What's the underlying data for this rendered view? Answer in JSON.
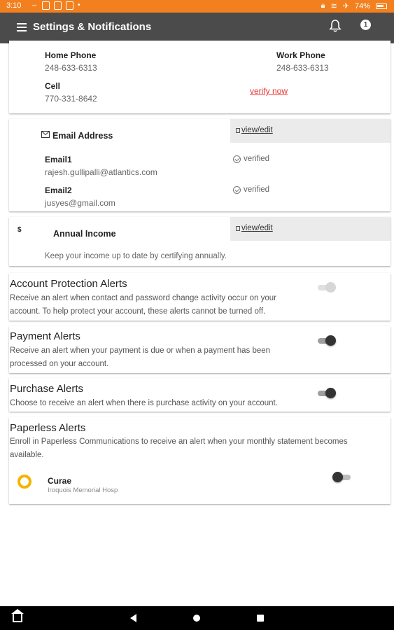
{
  "status_bar": {
    "time": "3:10",
    "battery": "74%"
  },
  "app_bar": {
    "title": "Settings & Notifications",
    "notification_count": "1"
  },
  "phones": {
    "home_label": "Home Phone",
    "home_value": "248-633-6313",
    "work_label": "Work Phone",
    "work_value": "248-633-6313",
    "cell_label": "Cell",
    "cell_value": "770-331-8642",
    "verify_link": "verify now"
  },
  "email": {
    "section_title": "Email Address",
    "view_edit": "view/edit",
    "items": [
      {
        "label": "Email1",
        "value": "rajesh.gullipalli@atlantics.com",
        "status": "verified"
      },
      {
        "label": "Email2",
        "value": "jusyes@gmail.com",
        "status": "verified"
      }
    ]
  },
  "income": {
    "icon_symbol": "$",
    "section_title": "Annual Income",
    "view_edit": "view/edit",
    "description": "Keep your income up to date by certifying annually."
  },
  "alerts": {
    "account_protection": {
      "title": "Account Protection Alerts",
      "description": "Receive an alert when contact and password change activity occur on your account. To help protect your account, these alerts cannot be turned off.",
      "toggle_state": "on-disabled"
    },
    "payment": {
      "title": "Payment Alerts",
      "description": "Receive an alert when your payment is due or when a payment has been processed on your account.",
      "toggle_state": "on"
    },
    "purchase": {
      "title": "Purchase Alerts",
      "description": "Choose to receive an alert when there is purchase activity on your account.",
      "toggle_state": "on"
    },
    "paperless": {
      "title": "Paperless Alerts",
      "description": "Enroll in Paperless Communications to receive an alert when your monthly statement becomes available.",
      "account_name": "Curae",
      "account_sub": "Iroquois Memorial Hosp",
      "toggle_state": "off"
    }
  },
  "colors": {
    "status_bar": "#f2801f",
    "app_bar": "#4b4b4b",
    "link_red": "#e53935",
    "logo_yellow": "#f4b400"
  }
}
